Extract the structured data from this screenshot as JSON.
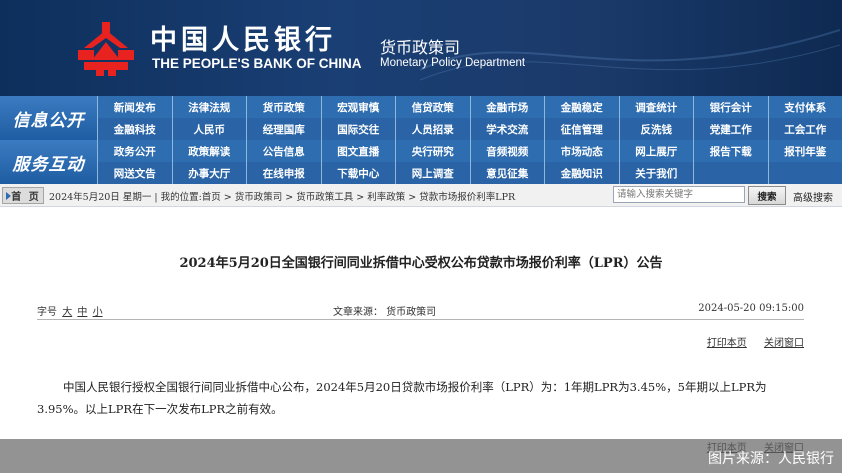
{
  "header": {
    "bank_cn": "中国人民银行",
    "bank_en": "THE PEOPLE'S BANK OF CHINA",
    "dept_cn": "货币政策司",
    "dept_en": "Monetary Policy Department",
    "logo_icon": "pboc-logo-icon",
    "logo_color": "#e8231f"
  },
  "nav": {
    "info_label": "信息公开",
    "service_label": "服务互动",
    "rows": [
      [
        "新闻发布",
        "法律法规",
        "货币政策",
        "宏观审慎",
        "信贷政策",
        "金融市场",
        "金融稳定",
        "调查统计",
        "银行会计",
        "支付体系"
      ],
      [
        "金融科技",
        "人民币",
        "经理国库",
        "国际交往",
        "人员招录",
        "学术交流",
        "征信管理",
        "反洗钱",
        "党建工作",
        "工会工作"
      ],
      [
        "政务公开",
        "政策解读",
        "公告信息",
        "图文直播",
        "央行研究",
        "音频视频",
        "市场动态",
        "网上展厅",
        "报告下载",
        "报刊年鉴"
      ],
      [
        "网送文告",
        "办事大厅",
        "在线申报",
        "下载中心",
        "网上调查",
        "意见征集",
        "金融知识",
        "关于我们"
      ]
    ]
  },
  "breadcrumb": {
    "home": "首 页",
    "text": "2024年5月20日 星期一 | 我的位置:首页 > 货币政策司 > 货币政策工具 > 利率政策 > 贷款市场报价利率LPR"
  },
  "search": {
    "placeholder": "请输入搜索关键字",
    "button": "搜索",
    "advanced": "高级搜索"
  },
  "article": {
    "title": "2024年5月20日全国银行间同业拆借中心受权公布贷款市场报价利率（LPR）公告",
    "font_size_label": "字号",
    "size_large": "大",
    "size_medium": "中",
    "size_small": "小",
    "source": "文章来源：  货币政策司",
    "date": "2024-05-20 09:15:00",
    "print": "打印本页",
    "close": "关闭窗口",
    "body": "中国人民银行授权全国银行间同业拆借中心公布，2024年5月20日贷款市场报价利率（LPR）为：1年期LPR为3.45%，5年期以上LPR为3.95%。以上LPR在下一次发布LPR之前有效。"
  },
  "footer": {
    "print": "打印本页",
    "close": "关闭窗口",
    "credit": "图片来源：人民银行"
  },
  "colors": {
    "header_bg": "#0d2f5c",
    "nav_bg": "#2e6db0",
    "nav_label_bg": "#3b7bc0"
  }
}
